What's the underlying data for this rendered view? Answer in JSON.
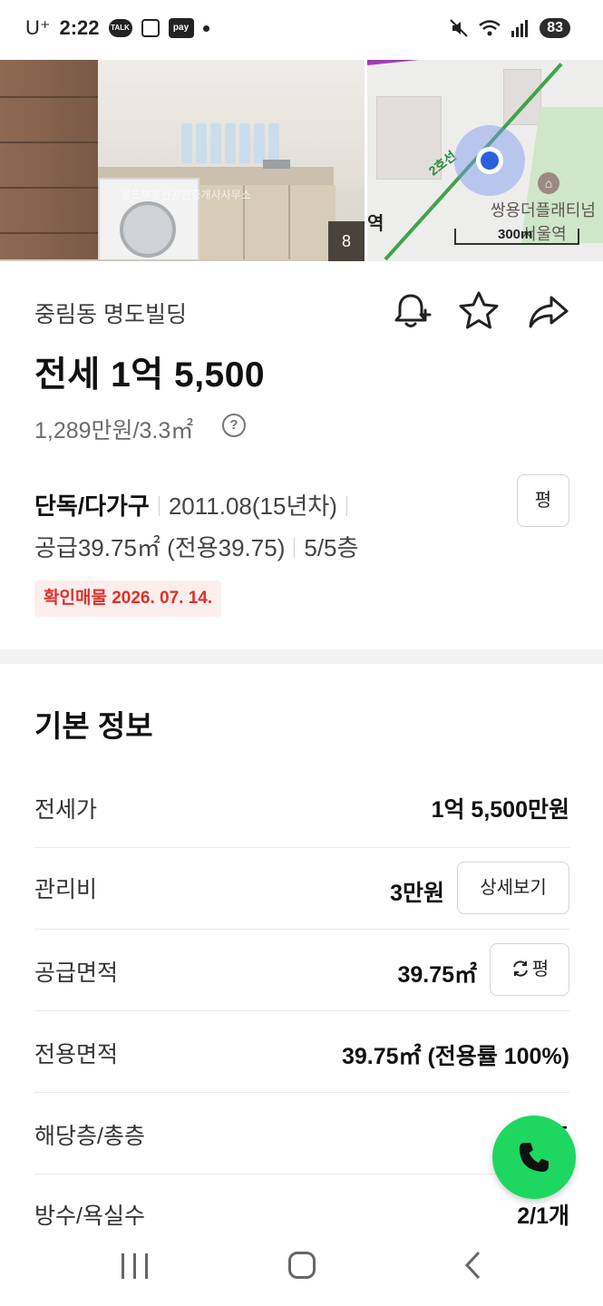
{
  "status_bar": {
    "carrier": "U⁺",
    "time": "2:22",
    "talk_label": "TALK",
    "pay_label": "pay",
    "battery": "83"
  },
  "photo": {
    "watermark": "골드부동산공인중개사사무소",
    "count": "8"
  },
  "map": {
    "line_label": "2호선",
    "poi_building": "쌍용더플래티넘",
    "poi_station": "서울역",
    "left_edge_text": "역",
    "scale": "300m"
  },
  "listing": {
    "address": "중림동 명도빌딩",
    "price": "전세 1억 5,500",
    "unit_price": "1,289만원/3.3㎡",
    "type": "단독/다가구",
    "built": "2011.08(15년차)",
    "area": "공급39.75㎡ (전용39.75)",
    "floor": "5/5층",
    "pyeong_button": "평",
    "verified": "확인매물 2026. 07. 14."
  },
  "basic_info": {
    "title": "기본 정보",
    "rows": [
      {
        "label": "전세가",
        "value": "1억 5,500만원"
      },
      {
        "label": "관리비",
        "value": "3만원",
        "button": "상세보기"
      },
      {
        "label": "공급면적",
        "value": "39.75㎡",
        "button": "평"
      },
      {
        "label": "전용면적",
        "value": "39.75㎡ (전용률 100%)"
      },
      {
        "label": "해당층/총층",
        "value": "5/5층"
      },
      {
        "label": "방수/욕실수",
        "value": "2/1개"
      }
    ]
  },
  "colors": {
    "verify_text": "#e0302a",
    "verify_bg": "#fdeeee",
    "call_button": "#1ed760",
    "map_location": "#2b5fe0"
  }
}
